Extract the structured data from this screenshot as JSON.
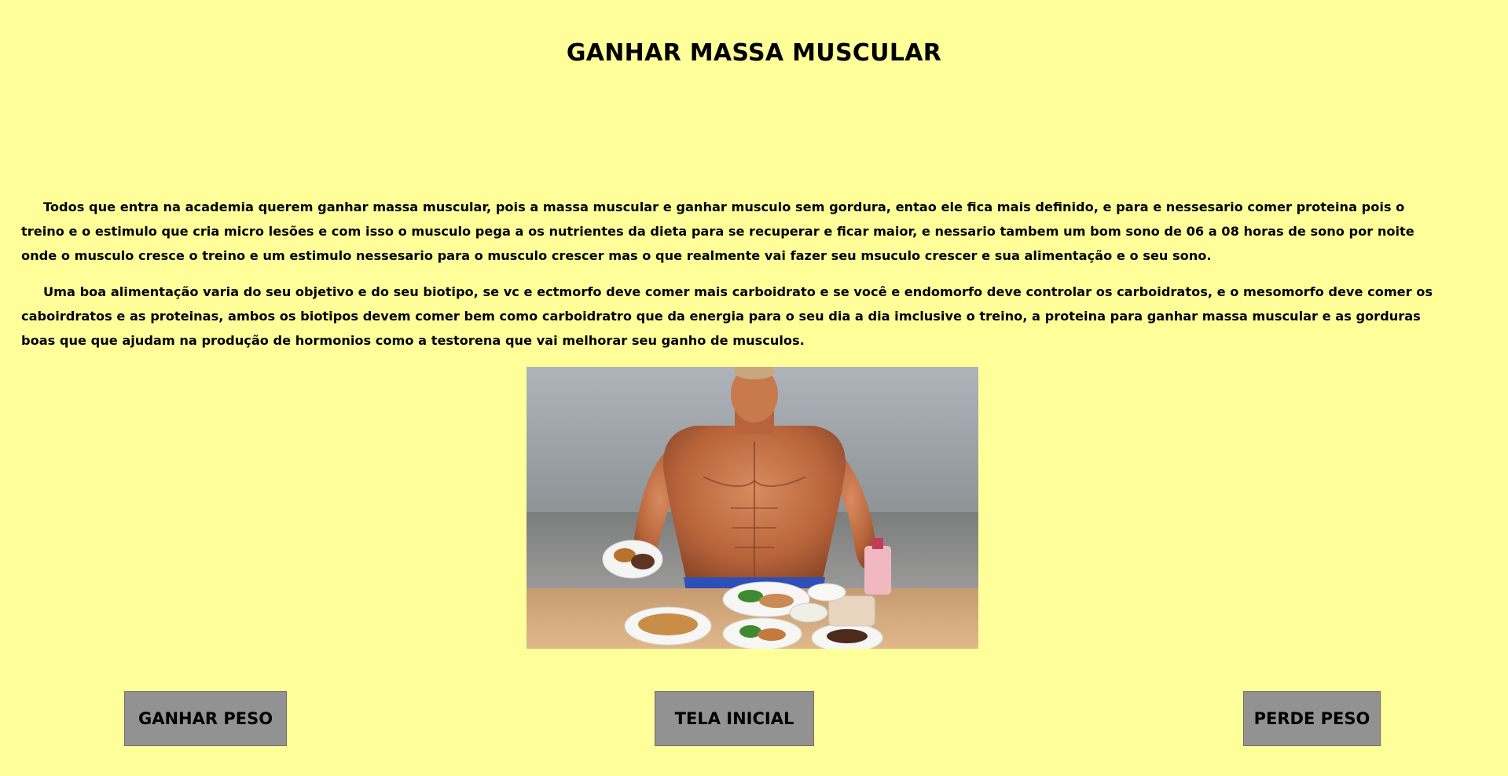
{
  "page": {
    "title": "GANHAR MASSA MUSCULAR",
    "background_color": "#ffff99"
  },
  "content": {
    "paragraph_1": "Todos que entra na academia querem ganhar massa muscular, pois a massa muscular e ganhar musculo sem gordura, entao ele fica mais definido, e para e nessesario comer proteina pois o treino e o estimulo que cria micro lesões e com isso o musculo pega a os nutrientes da dieta para se recuperar e ficar maior, e nessario tambem um bom sono de 06 a 08 horas de sono por noite onde o musculo cresce o treino e um estimulo nessesario para o musculo crescer mas o que realmente vai fazer seu msuculo crescer e sua alimentação e o seu sono.",
    "paragraph_2": "Uma boa alimentação varia do seu objetivo e do seu biotipo, se vc e ectmorfo deve comer mais carboidrato e se você e endomorfo deve controlar os carboidratos, e o mesomorfo deve comer os caboirdratos e as proteinas, ambos os biotipos devem comer bem como carboidratro que da energia para o seu dia a dia imclusive o treino, a proteina para ganhar massa muscular e as gorduras boas que que ajudam na produção de hormonios como a testorena que vai melhorar seu ganho de musculos."
  },
  "image": {
    "subject": "muscular-man-with-meals"
  },
  "buttons": {
    "ganhar_peso": "GANHAR PESO",
    "tela_inicial": "TELA INICIAL",
    "perde_peso": "PERDE PESO",
    "color": "#929292"
  }
}
